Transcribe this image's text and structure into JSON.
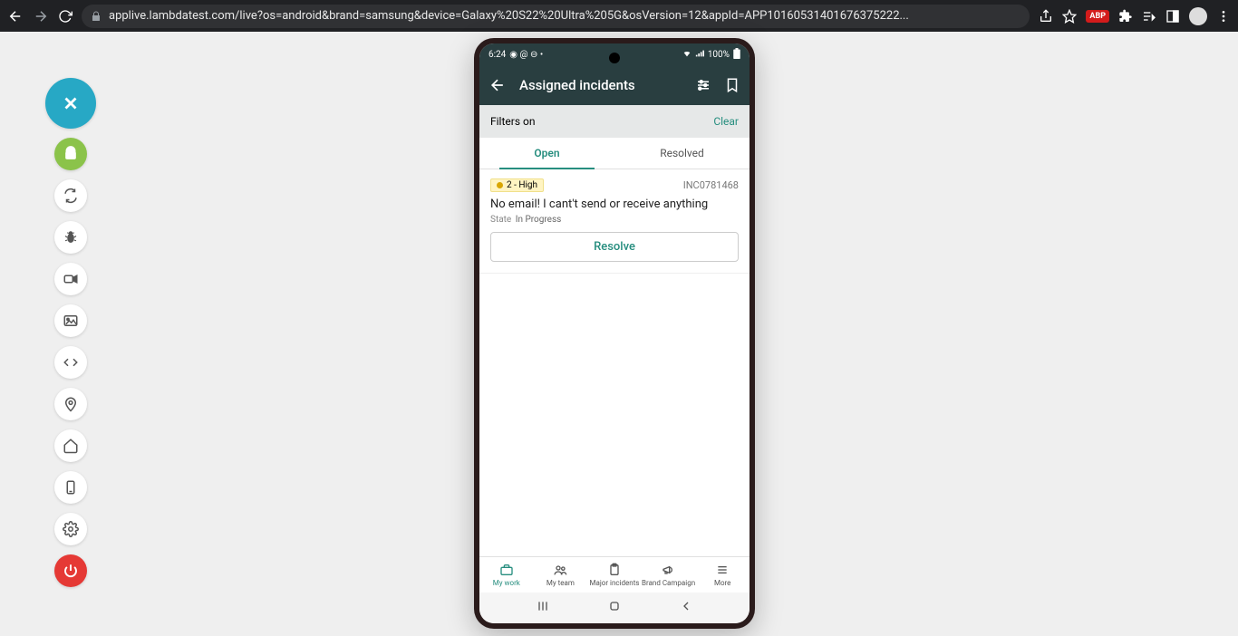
{
  "browser": {
    "url": "applive.lambdatest.com/live?os=android&brand=samsung&device=Galaxy%20S22%20Ultra%205G&osVersion=12&appId=APP10160531401676375222...",
    "abp_label": "ABP"
  },
  "status_bar": {
    "time": "6:24",
    "battery": "100%"
  },
  "app_header": {
    "title": "Assigned incidents"
  },
  "filter_row": {
    "label": "Filters on",
    "clear": "Clear"
  },
  "tabs": {
    "open": "Open",
    "resolved": "Resolved"
  },
  "card": {
    "severity": "2 - High",
    "id": "INC0781468",
    "title": "No email! I cant't send or receive anything",
    "state_label": "State",
    "state_value": "In Progress",
    "resolve": "Resolve"
  },
  "bottom_tabs": {
    "my_work": "My work",
    "my_team": "My team",
    "major_incidents": "Major incidents",
    "brand_campaign": "Brand Campaign",
    "more": "More"
  }
}
